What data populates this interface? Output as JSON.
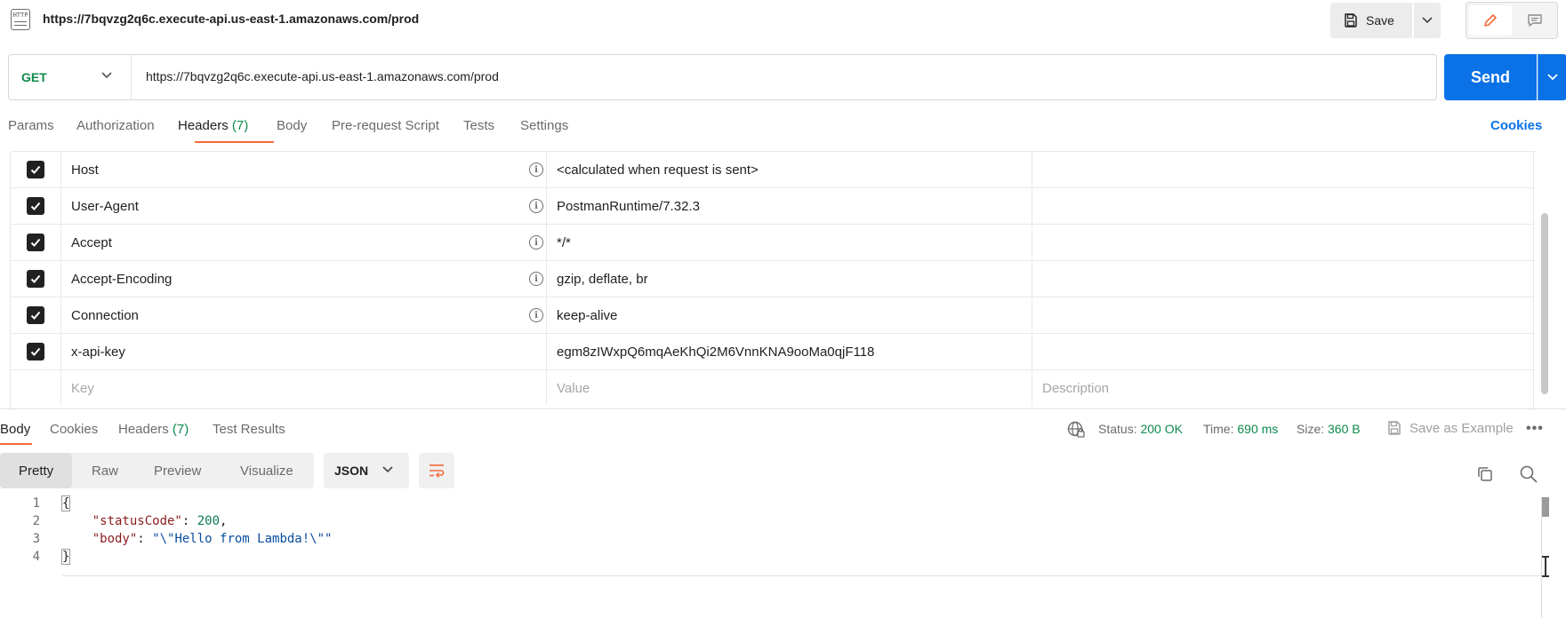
{
  "request": {
    "icon_text": "HTTP",
    "title": "https://7bqvzg2q6c.execute-api.us-east-1.amazonaws.com/prod",
    "save_label": "Save",
    "method": "GET",
    "url": "https://7bqvzg2q6c.execute-api.us-east-1.amazonaws.com/prod",
    "send_label": "Send"
  },
  "request_tabs": {
    "params": "Params",
    "authorization": "Authorization",
    "headers": "Headers",
    "headers_count": "(7)",
    "body": "Body",
    "prerequest": "Pre-request Script",
    "tests": "Tests",
    "settings": "Settings",
    "cookies": "Cookies"
  },
  "headers": [
    {
      "key": "Host",
      "value": "<calculated when request is sent>",
      "checked": true,
      "info": true
    },
    {
      "key": "User-Agent",
      "value": "PostmanRuntime/7.32.3",
      "checked": true,
      "info": true
    },
    {
      "key": "Accept",
      "value": "*/*",
      "checked": true,
      "info": true
    },
    {
      "key": "Accept-Encoding",
      "value": "gzip, deflate, br",
      "checked": true,
      "info": true
    },
    {
      "key": "Connection",
      "value": "keep-alive",
      "checked": true,
      "info": true
    },
    {
      "key": "x-api-key",
      "value": "egm8zIWxpQ6mqAeKhQi2M6VnnKNA9ooMa0qjF118",
      "checked": true,
      "info": false
    }
  ],
  "headers_placeholder": {
    "key": "Key",
    "value": "Value",
    "description": "Description"
  },
  "response_tabs": {
    "body": "Body",
    "cookies": "Cookies",
    "headers": "Headers",
    "headers_count": "(7)",
    "test_results": "Test Results"
  },
  "response_meta": {
    "status_label": "Status:",
    "status_value": "200 OK",
    "time_label": "Time:",
    "time_value": "690 ms",
    "size_label": "Size:",
    "size_value": "360 B",
    "save_example": "Save as Example",
    "more": "•••"
  },
  "view_modes": {
    "pretty": "Pretty",
    "raw": "Raw",
    "preview": "Preview",
    "visualize": "Visualize",
    "format": "JSON"
  },
  "code": {
    "line_numbers": [
      "1",
      "2",
      "3",
      "4"
    ],
    "open_brace": "{",
    "close_brace": "}",
    "k1": "\"statusCode\"",
    "v1": "200",
    "k2": "\"body\"",
    "v2": "\"\\\"Hello from Lambda!\\\"\"",
    "colon": ": ",
    "comma": ","
  },
  "colors": {
    "accent_orange": "#f26b3a",
    "send_blue": "#0a72e6",
    "method_green": "#0d8a4b"
  }
}
